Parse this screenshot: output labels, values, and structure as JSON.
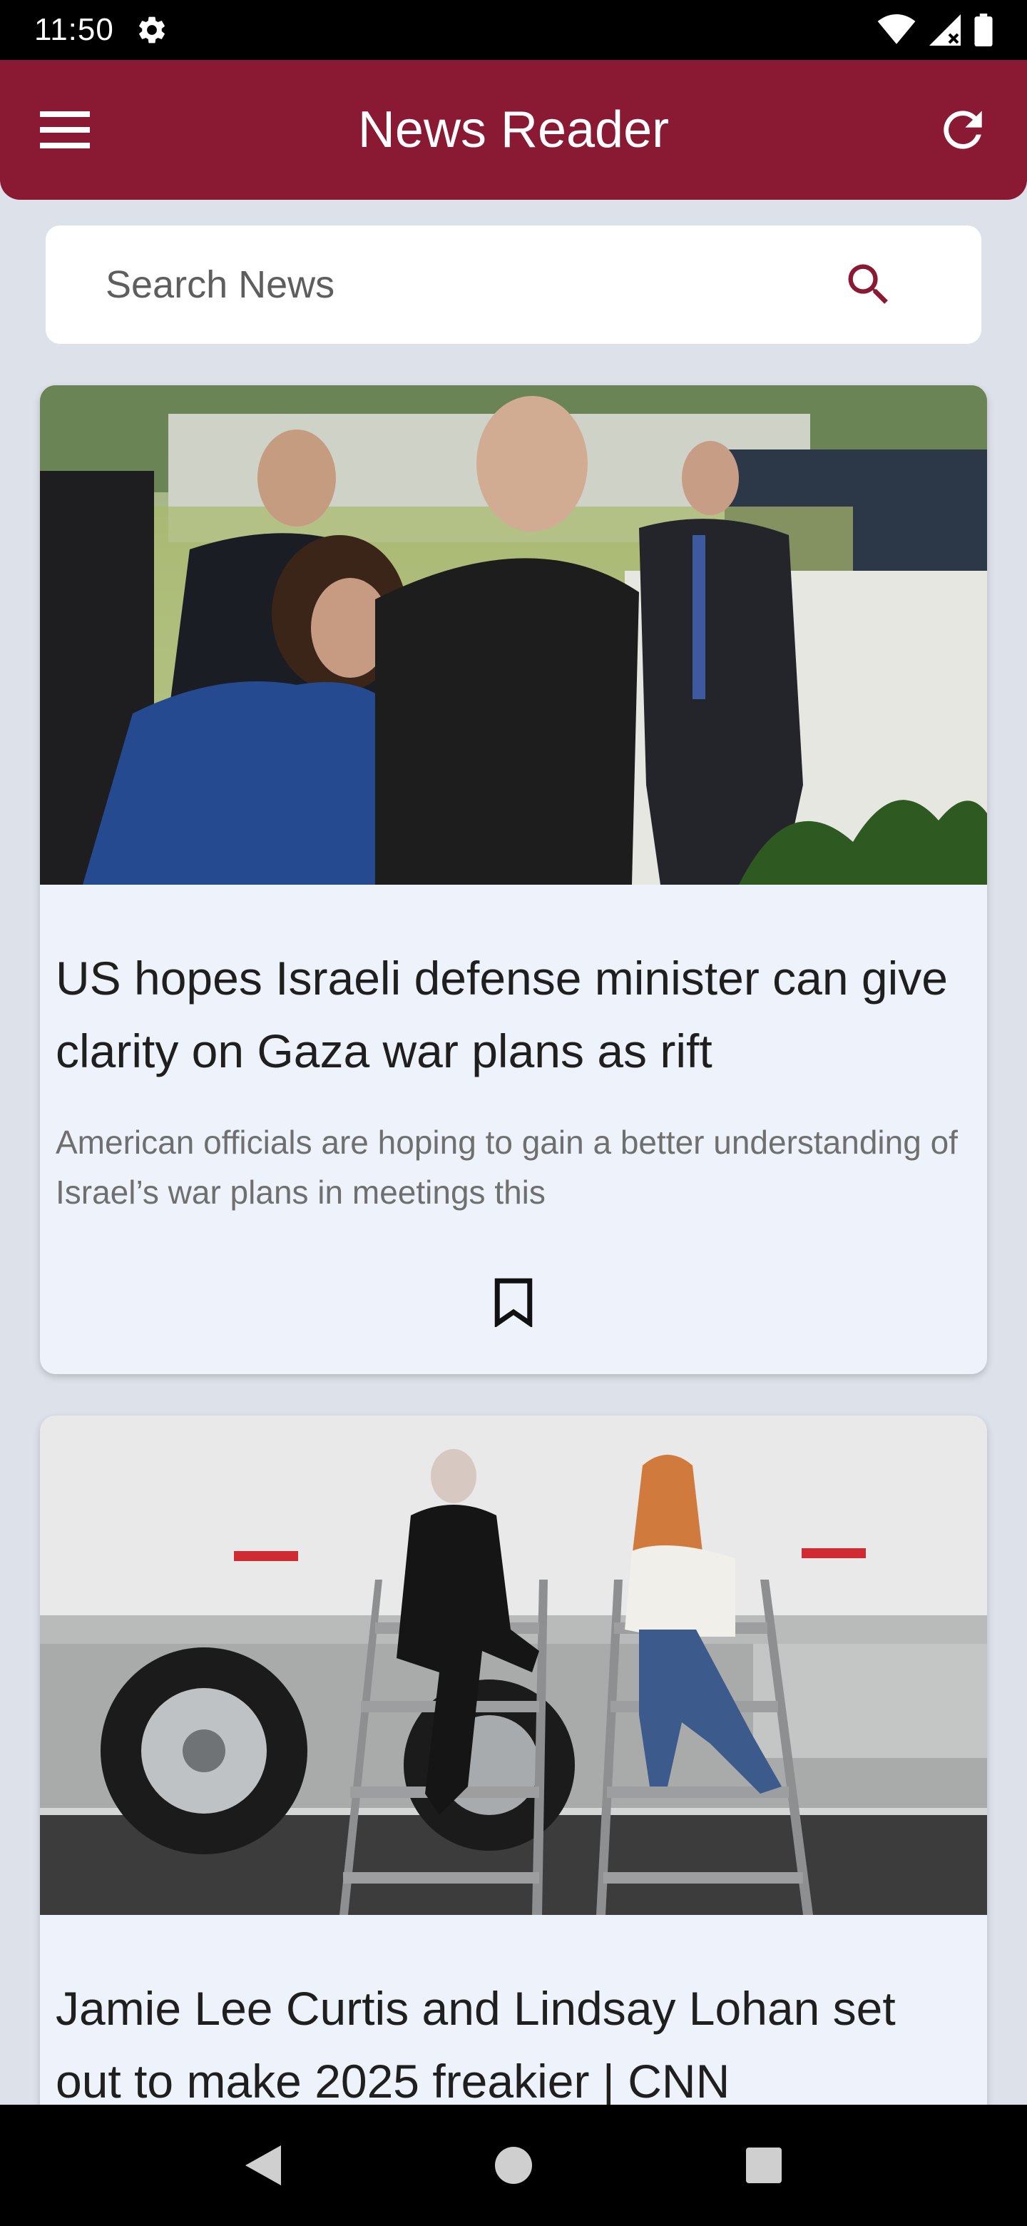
{
  "status_bar": {
    "time": "11:50",
    "icons": [
      "settings-gear-icon",
      "wifi-icon",
      "cell-signal-icon",
      "battery-icon"
    ]
  },
  "app_bar": {
    "title": "News Reader",
    "menu_icon": "hamburger-menu-icon",
    "refresh_icon": "refresh-icon",
    "background": "#8a1a34"
  },
  "search": {
    "placeholder": "Search News",
    "value": "",
    "icon": "search-icon",
    "icon_color": "#8a1a34"
  },
  "articles": [
    {
      "image": "news-photo",
      "headline": "US hopes Israeli defense minister can give clarity on Gaza war plans as rift",
      "description": "American officials are hoping to gain a better understanding of Israel’s war plans in meetings this",
      "bookmark_icon": "bookmark-outline-icon"
    },
    {
      "image": "news-photo",
      "headline": "Jamie Lee Curtis and Lindsay Lohan set out to make 2025 freakier | CNN"
    }
  ],
  "nav_bar": {
    "icons": [
      "back-icon",
      "home-icon",
      "recents-icon"
    ]
  },
  "colors": {
    "page_background": "#dde1e9",
    "card_background": "#eef3fb",
    "accent": "#8a1a34"
  }
}
